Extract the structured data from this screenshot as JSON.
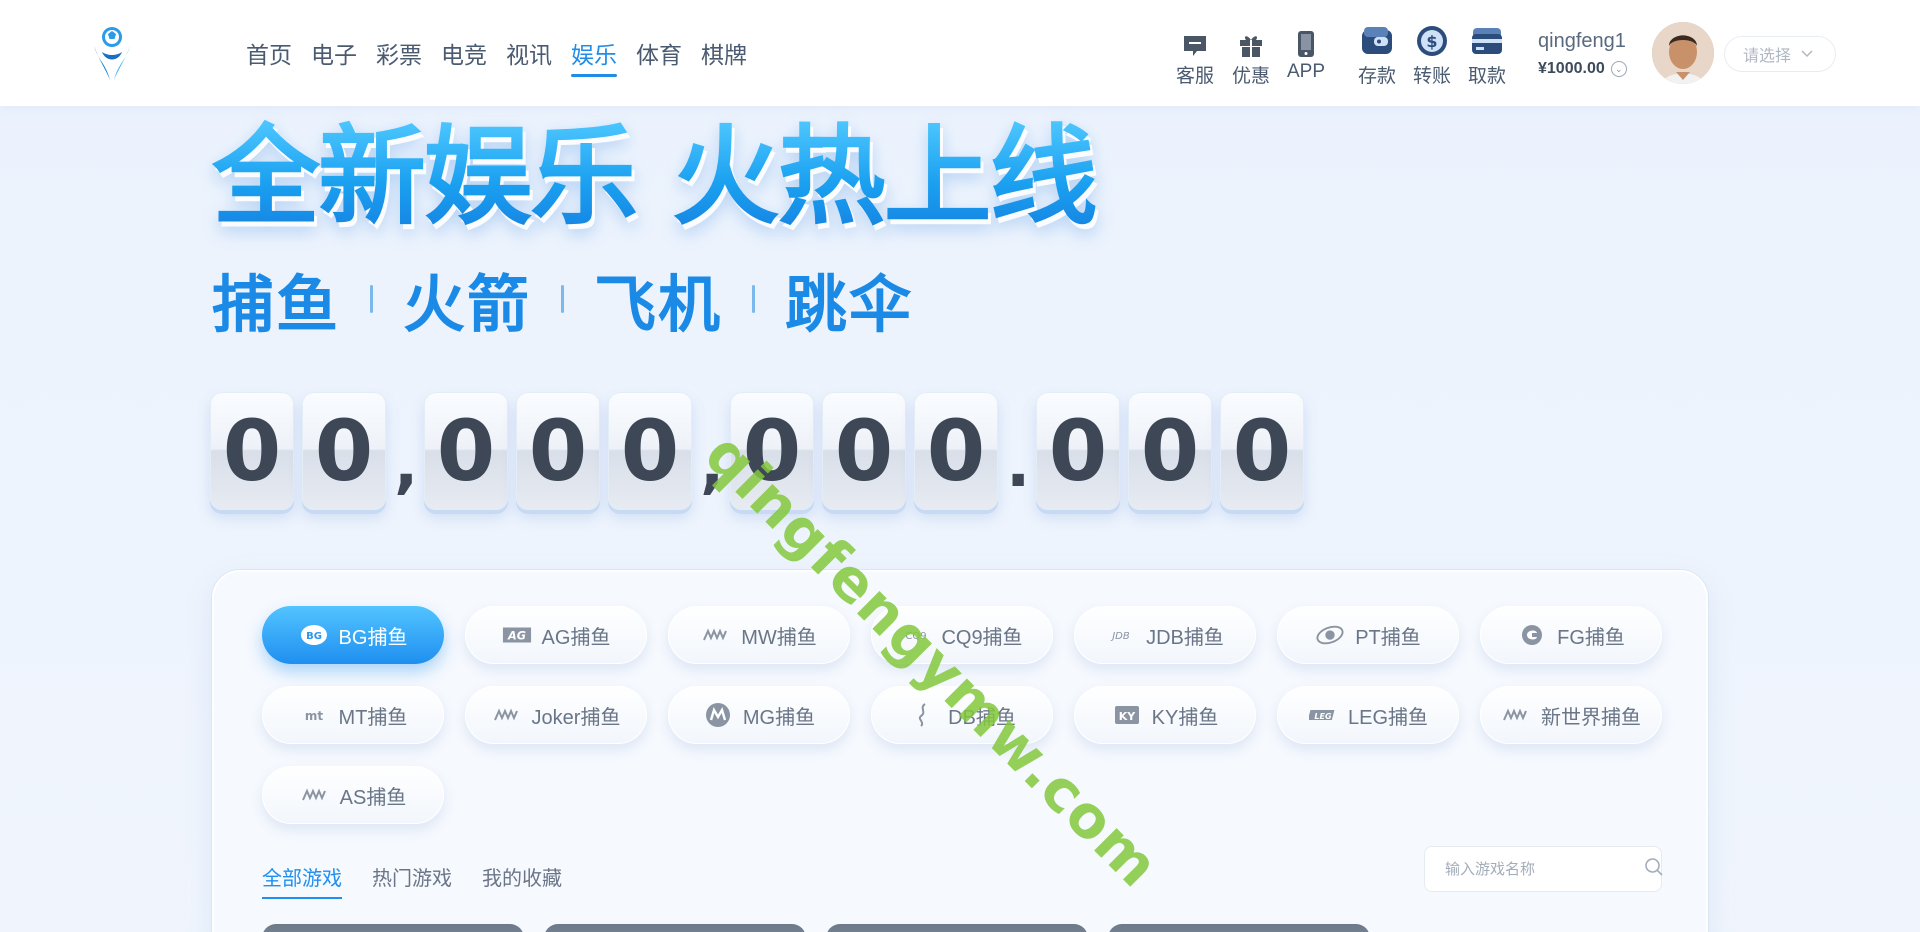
{
  "header": {
    "nav": [
      "首页",
      "电子",
      "彩票",
      "电竞",
      "视讯",
      "娱乐",
      "体育",
      "棋牌"
    ],
    "active_nav_index": 5,
    "tools": {
      "service": "客服",
      "promo": "优惠",
      "app": "APP",
      "deposit": "存款",
      "transfer": "转账",
      "withdraw": "取款"
    },
    "user": {
      "name": "qingfeng1",
      "balance": "¥1000.00"
    },
    "select_placeholder": "请选择"
  },
  "hero": {
    "title": "全新娱乐 火热上线",
    "subtitles": [
      "捕鱼",
      "火箭",
      "飞机",
      "跳伞"
    ],
    "counter": [
      "0",
      "0",
      ",",
      "0",
      "0",
      "0",
      ",",
      "0",
      "0",
      "0",
      ".",
      "0",
      "0",
      "0"
    ]
  },
  "watermark": "qingfengymw.com",
  "panel": {
    "chips": [
      {
        "label": "BG捕鱼",
        "icon": "bg-logo-icon",
        "active": true
      },
      {
        "label": "AG捕鱼",
        "icon": "ag-logo-icon"
      },
      {
        "label": "MW捕鱼",
        "icon": "mw-logo-icon"
      },
      {
        "label": "CQ9捕鱼",
        "icon": "cq9-logo-icon"
      },
      {
        "label": "JDB捕鱼",
        "icon": "jdb-logo-icon"
      },
      {
        "label": "PT捕鱼",
        "icon": "pt-logo-icon"
      },
      {
        "label": "FG捕鱼",
        "icon": "fg-logo-icon"
      },
      {
        "label": "MT捕鱼",
        "icon": "mt-logo-icon"
      },
      {
        "label": "Joker捕鱼",
        "icon": "joker-logo-icon"
      },
      {
        "label": "MG捕鱼",
        "icon": "mg-logo-icon"
      },
      {
        "label": "DB捕鱼",
        "icon": "db-logo-icon"
      },
      {
        "label": "KY捕鱼",
        "icon": "ky-logo-icon"
      },
      {
        "label": "LEG捕鱼",
        "icon": "leg-logo-icon"
      },
      {
        "label": "新世界捕鱼",
        "icon": "xsj-logo-icon"
      },
      {
        "label": "AS捕鱼",
        "icon": "as-logo-icon"
      }
    ],
    "tabs": [
      "全部游戏",
      "热门游戏",
      "我的收藏"
    ],
    "active_tab_index": 0,
    "search_placeholder": "输入游戏名称"
  },
  "colors": {
    "accent": "#1f8ff0",
    "nav_active": "#1f8de8",
    "background": "#eaf2fd"
  }
}
